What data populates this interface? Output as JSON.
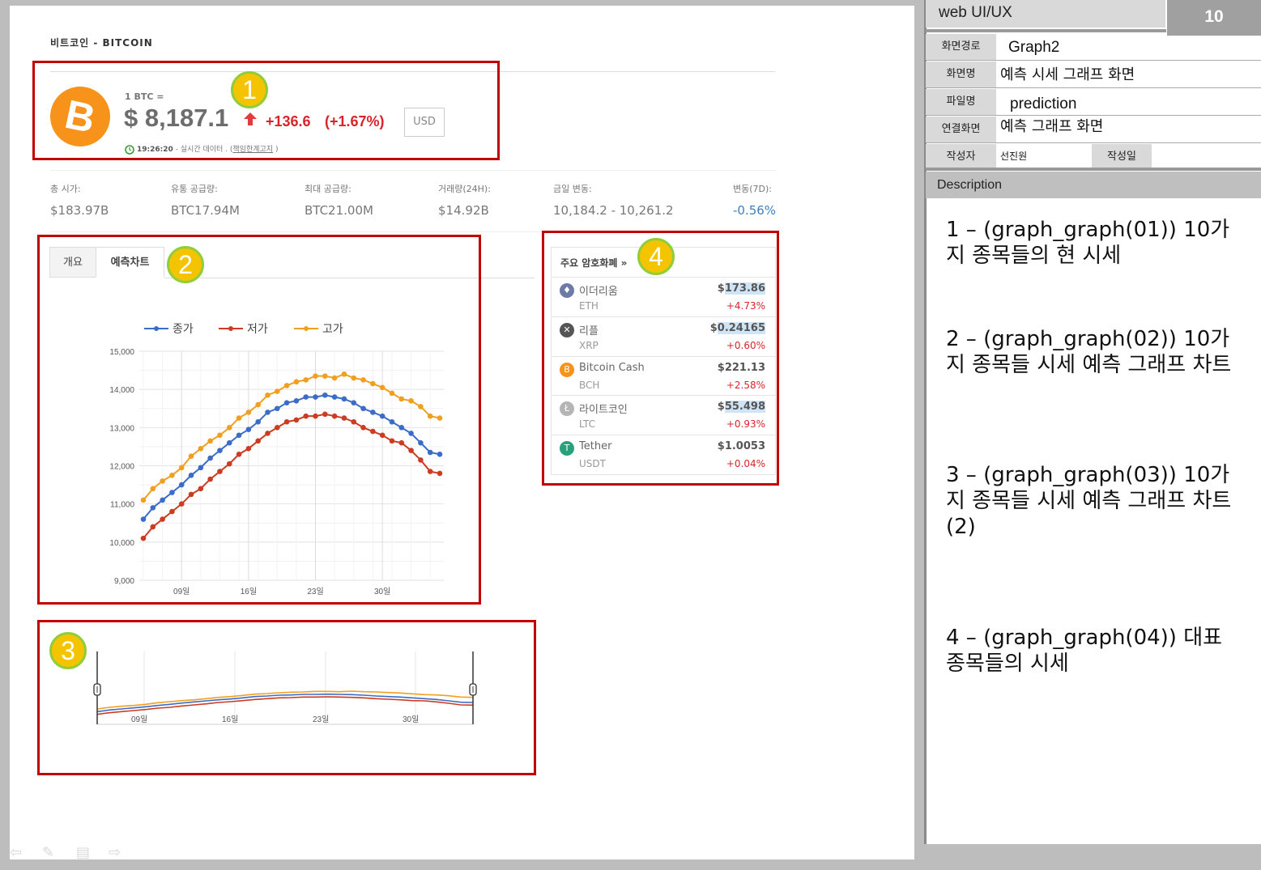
{
  "page": {
    "title": "비트코인 - BITCOIN"
  },
  "ticker": {
    "unit_label": "1 BTC =",
    "price": "$ 8,187.1",
    "change": "+136.6",
    "change_pct": "(+1.67%)",
    "currency_button": "USD",
    "time": "19:26:20",
    "live_note": "- 실시간 데이터 . (",
    "disclaimer_link": "책임한계고지",
    "note_close": ")"
  },
  "stats": [
    {
      "label": "총 시가:",
      "value": "$183.97B"
    },
    {
      "label": "유통 공급량:",
      "value": "BTC17.94M"
    },
    {
      "label": "최대 공급량:",
      "value": "BTC21.00M"
    },
    {
      "label": "거래량(24H):",
      "value": "$14.92B"
    },
    {
      "label": "금일 변동:",
      "value": "10,184.2 - 10,261.2"
    },
    {
      "label": "변동(7D):",
      "value": "-0.56%"
    }
  ],
  "tabs": [
    {
      "label": "개요"
    },
    {
      "label": "예측차트"
    }
  ],
  "chart_data": [
    {
      "type": "line",
      "legend": [
        "종가",
        "저가",
        "고가"
      ],
      "legend_position": "top",
      "grid": true,
      "ylim": [
        9000,
        15000
      ],
      "y_ticks": [
        "15,000",
        "14,000",
        "13,000",
        "12,000",
        "11,000",
        "10,000",
        "9,000"
      ],
      "x_ticks": [
        "09일",
        "16일",
        "23일",
        "30일"
      ],
      "x": [
        1,
        2,
        3,
        4,
        5,
        6,
        7,
        8,
        9,
        10,
        11,
        12,
        13,
        14,
        15,
        16,
        17,
        18,
        19,
        20,
        21,
        22,
        23,
        24,
        25,
        26,
        27,
        28,
        29,
        30,
        31,
        32
      ],
      "series": [
        {
          "name": "종가",
          "color": "#3b6cc7",
          "values": [
            10600,
            10900,
            11100,
            11300,
            11500,
            11750,
            11950,
            12200,
            12400,
            12600,
            12800,
            12950,
            13150,
            13400,
            13500,
            13650,
            13700,
            13800,
            13800,
            13850,
            13800,
            13750,
            13650,
            13500,
            13400,
            13300,
            13150,
            13000,
            12850,
            12600,
            12350,
            12300
          ]
        },
        {
          "name": "저가",
          "color": "#cc3b22",
          "values": [
            10100,
            10400,
            10600,
            10800,
            11000,
            11250,
            11400,
            11650,
            11850,
            12050,
            12300,
            12450,
            12650,
            12850,
            13000,
            13150,
            13200,
            13300,
            13300,
            13350,
            13300,
            13250,
            13150,
            13000,
            12900,
            12800,
            12650,
            12600,
            12400,
            12150,
            11850,
            11800
          ]
        },
        {
          "name": "고가",
          "color": "#f0a020",
          "values": [
            11100,
            11400,
            11600,
            11750,
            11950,
            12250,
            12450,
            12650,
            12800,
            13000,
            13250,
            13400,
            13600,
            13850,
            13950,
            14100,
            14200,
            14250,
            14350,
            14350,
            14300,
            14400,
            14300,
            14250,
            14150,
            14050,
            13900,
            13750,
            13700,
            13550,
            13300,
            13250
          ]
        }
      ]
    },
    {
      "type": "line",
      "x_ticks": [
        "09일",
        "16일",
        "23일",
        "30일"
      ],
      "series": [
        {
          "name": "종가",
          "color": "#3b6cc7"
        },
        {
          "name": "저가",
          "color": "#cc3b22"
        },
        {
          "name": "고가",
          "color": "#f0a020"
        }
      ]
    }
  ],
  "coins": {
    "header": "주요 암호화폐 »",
    "items": [
      {
        "name": "이더리움",
        "symbol": "ETH",
        "price_prefix": "$",
        "price_hl": "173.86",
        "change": "+4.73%",
        "icon": "ethereum-icon",
        "color": "#6f7ba7"
      },
      {
        "name": "리플",
        "symbol": "XRP",
        "price_prefix": "$",
        "price_hl": "0.24165",
        "change": "+0.60%",
        "icon": "ripple-icon",
        "color": "#555555"
      },
      {
        "name": "Bitcoin Cash",
        "symbol": "BCH",
        "price_prefix": "$221.13",
        "price_hl": "",
        "change": "+2.58%",
        "icon": "bitcoin-cash-icon",
        "color": "#f7931a"
      },
      {
        "name": "라이트코인",
        "symbol": "LTC",
        "price_prefix": "$",
        "price_hl": "55.498",
        "change": "+0.93%",
        "icon": "litecoin-icon",
        "color": "#b5b5b5"
      },
      {
        "name": "Tether",
        "symbol": "USDT",
        "price_prefix": "$1.0053",
        "price_hl": "",
        "change": "+0.04%",
        "icon": "tether-icon",
        "color": "#26a17b"
      }
    ]
  },
  "badges": [
    "1",
    "2",
    "3",
    "4"
  ],
  "spec": {
    "header": "web UI/UX",
    "page_no": "10",
    "rows": [
      {
        "label": "화면경로",
        "value": "Graph2"
      },
      {
        "label": "화면명",
        "value": "예측 시세 그래프 화면"
      },
      {
        "label": "파일명",
        "value": "prediction"
      },
      {
        "label": "연결화면",
        "value": "예측 그래프 화면"
      }
    ],
    "author_label": "작성자",
    "author": "선진원",
    "date_label": "작성일",
    "description_label": "Description",
    "descriptions": [
      "1 – (graph_graph(01)) 10가지 종목들의 현 시세",
      "2 – (graph_graph(02)) 10가지 종목들 시세 예측 그래프 차트",
      "3 – (graph_graph(03)) 10가지 종목들 시세 예측 그래프 차트(2)",
      "4 – (graph_graph(04)) 대표 종목들의 시세"
    ]
  }
}
